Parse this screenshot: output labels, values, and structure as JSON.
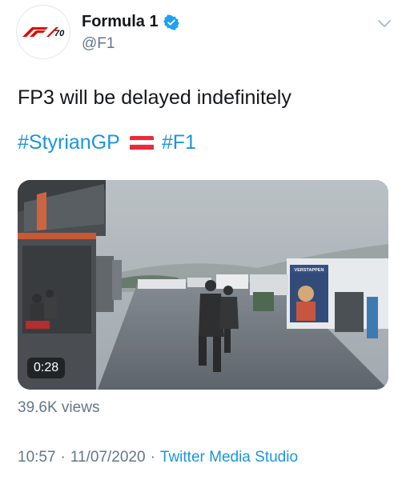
{
  "author": {
    "display_name": "Formula 1",
    "handle": "@F1",
    "avatar_logo": "F1-70-logo",
    "verified": true,
    "verified_icon": "verified-badge-icon"
  },
  "tweet": {
    "text": "FP3 will be delayed indefinitely",
    "hashtag_1": "#StyrianGP",
    "flag_icon": "austria-flag-icon",
    "hashtag_2": "#F1"
  },
  "media": {
    "type": "video",
    "duration": "0:28",
    "sign_text": "VERSTAPPEN"
  },
  "stats": {
    "views": "39.6K views"
  },
  "footer": {
    "time": "10:57",
    "separator": "·",
    "date": "11/07/2020",
    "source": "Twitter Media Studio"
  },
  "colors": {
    "link": "#1b95e0",
    "secondary_text": "#657786",
    "f1_red": "#e10600"
  }
}
